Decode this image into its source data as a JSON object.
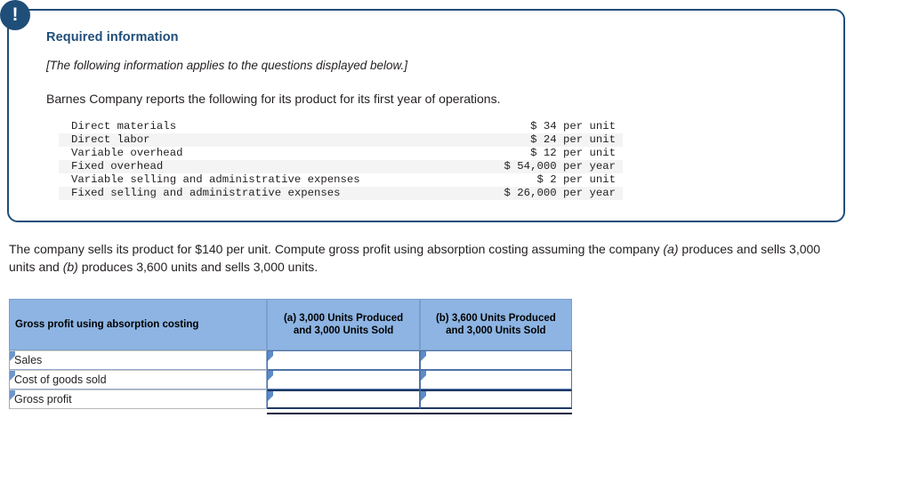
{
  "panel": {
    "alert_icon": "exclamation-icon",
    "heading": "Required information",
    "applies_note": "[The following information applies to the questions displayed below.]",
    "intro": "Barnes Company reports the following for its product for its first year of operations.",
    "cost_table": {
      "rows": [
        {
          "label": "Direct materials",
          "value": "$ 34 per unit"
        },
        {
          "label": "Direct labor",
          "value": "$ 24 per unit"
        },
        {
          "label": "Variable overhead",
          "value": "$ 12 per unit"
        },
        {
          "label": "Fixed overhead",
          "value": "$ 54,000 per year"
        },
        {
          "label": "Variable selling and administrative expenses",
          "value": "$ 2 per unit"
        },
        {
          "label": "Fixed selling and administrative expenses",
          "value": "$ 26,000 per year"
        }
      ]
    }
  },
  "question": {
    "part1": "The company sells its product for $140 per unit. Compute gross profit using absorption costing assuming the company ",
    "label_a": "(a)",
    "part2": " produces and sells 3,000 units and ",
    "label_b": "(b)",
    "part3": " produces 3,600 units and sells 3,000 units."
  },
  "answer_table": {
    "header": {
      "label": "Gross profit using absorption costing",
      "col_a_line1": "(a) 3,000 Units Produced",
      "col_a_line2": "and 3,000 Units Sold",
      "col_b_line1": "(b) 3,600 Units Produced",
      "col_b_line2": "and 3,000 Units Sold"
    },
    "rows": [
      {
        "label": "Sales",
        "col_a": "",
        "col_b": ""
      },
      {
        "label": "Cost of goods sold",
        "col_a": "",
        "col_b": ""
      },
      {
        "label": "Gross profit",
        "col_a": "",
        "col_b": ""
      }
    ]
  },
  "colors": {
    "panel_border": "#1f4e79",
    "heading": "#1f4e79",
    "header_fill": "#8db4e2",
    "input_border": "#4f72a8",
    "total_rule": "#1f3864"
  }
}
